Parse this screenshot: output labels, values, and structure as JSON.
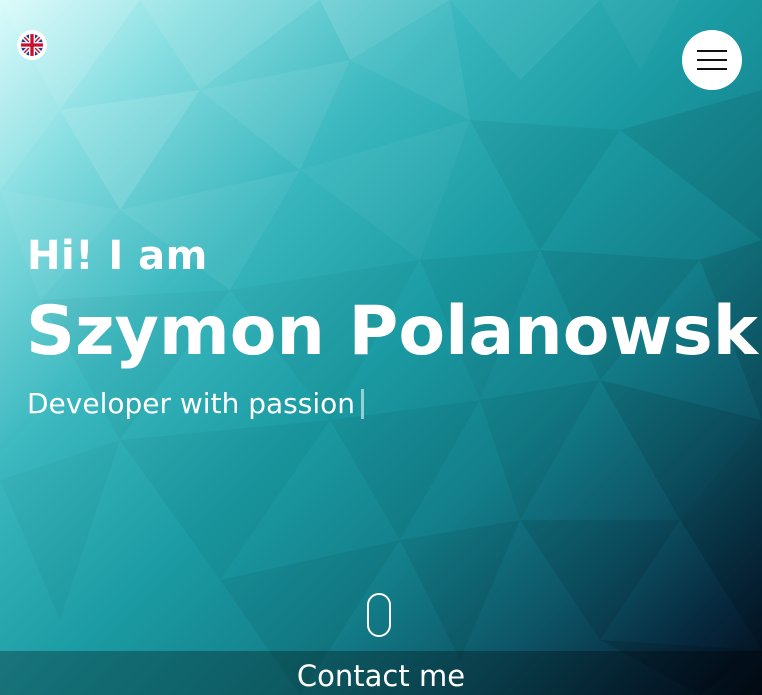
{
  "theme": {
    "accent": "#1b9ba3",
    "text": "#ffffff",
    "button_bg": "#ffffff"
  },
  "language": {
    "icon": "uk-flag-icon"
  },
  "menu": {
    "icon": "hamburger-menu-icon"
  },
  "hero": {
    "greeting": "Hi! I am",
    "name": "Szymon Polanowski",
    "tagline": "Developer with passion"
  },
  "scroll": {
    "icon": "mouse-scroll-icon"
  },
  "contact": {
    "label": "Contact me"
  }
}
